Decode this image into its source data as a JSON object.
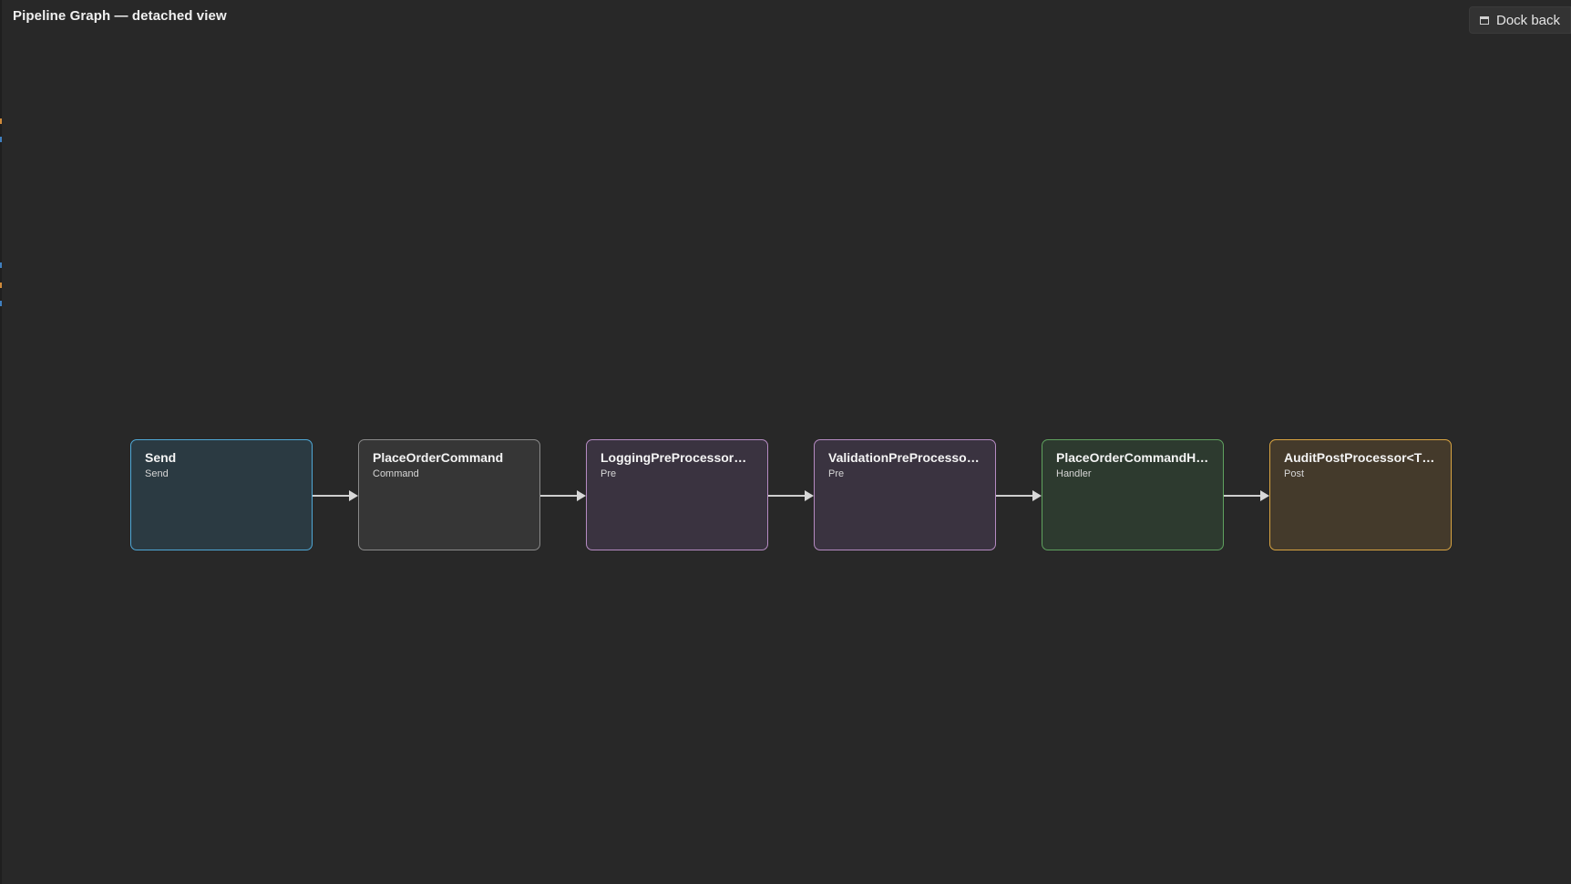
{
  "header": {
    "title": "Pipeline Graph — detached view",
    "dock_back_label": "Dock back",
    "dock_icon": "dock-window-icon"
  },
  "pipeline": {
    "nodes": [
      {
        "id": "send",
        "title": "Send",
        "kind": "Send",
        "border": "#4fa8d6",
        "fill": "#2b3a42"
      },
      {
        "id": "command",
        "title": "PlaceOrderCommand",
        "kind": "Command",
        "border": "#8a8a8a",
        "fill": "#363636"
      },
      {
        "id": "logging",
        "title": "LoggingPreProcessor<T...",
        "kind": "Pre",
        "border": "#b58bc2",
        "fill": "#3a3340"
      },
      {
        "id": "validation",
        "title": "ValidationPreProcessor<...",
        "kind": "Pre",
        "border": "#b58bc2",
        "fill": "#3a3340"
      },
      {
        "id": "handler",
        "title": "PlaceOrderCommandHa...",
        "kind": "Handler",
        "border": "#5fa25f",
        "fill": "#2d3a2f"
      },
      {
        "id": "post",
        "title": "AuditPostProcessor<TRe...",
        "kind": "Post",
        "border": "#d9a441",
        "fill": "#443a2b"
      }
    ]
  }
}
